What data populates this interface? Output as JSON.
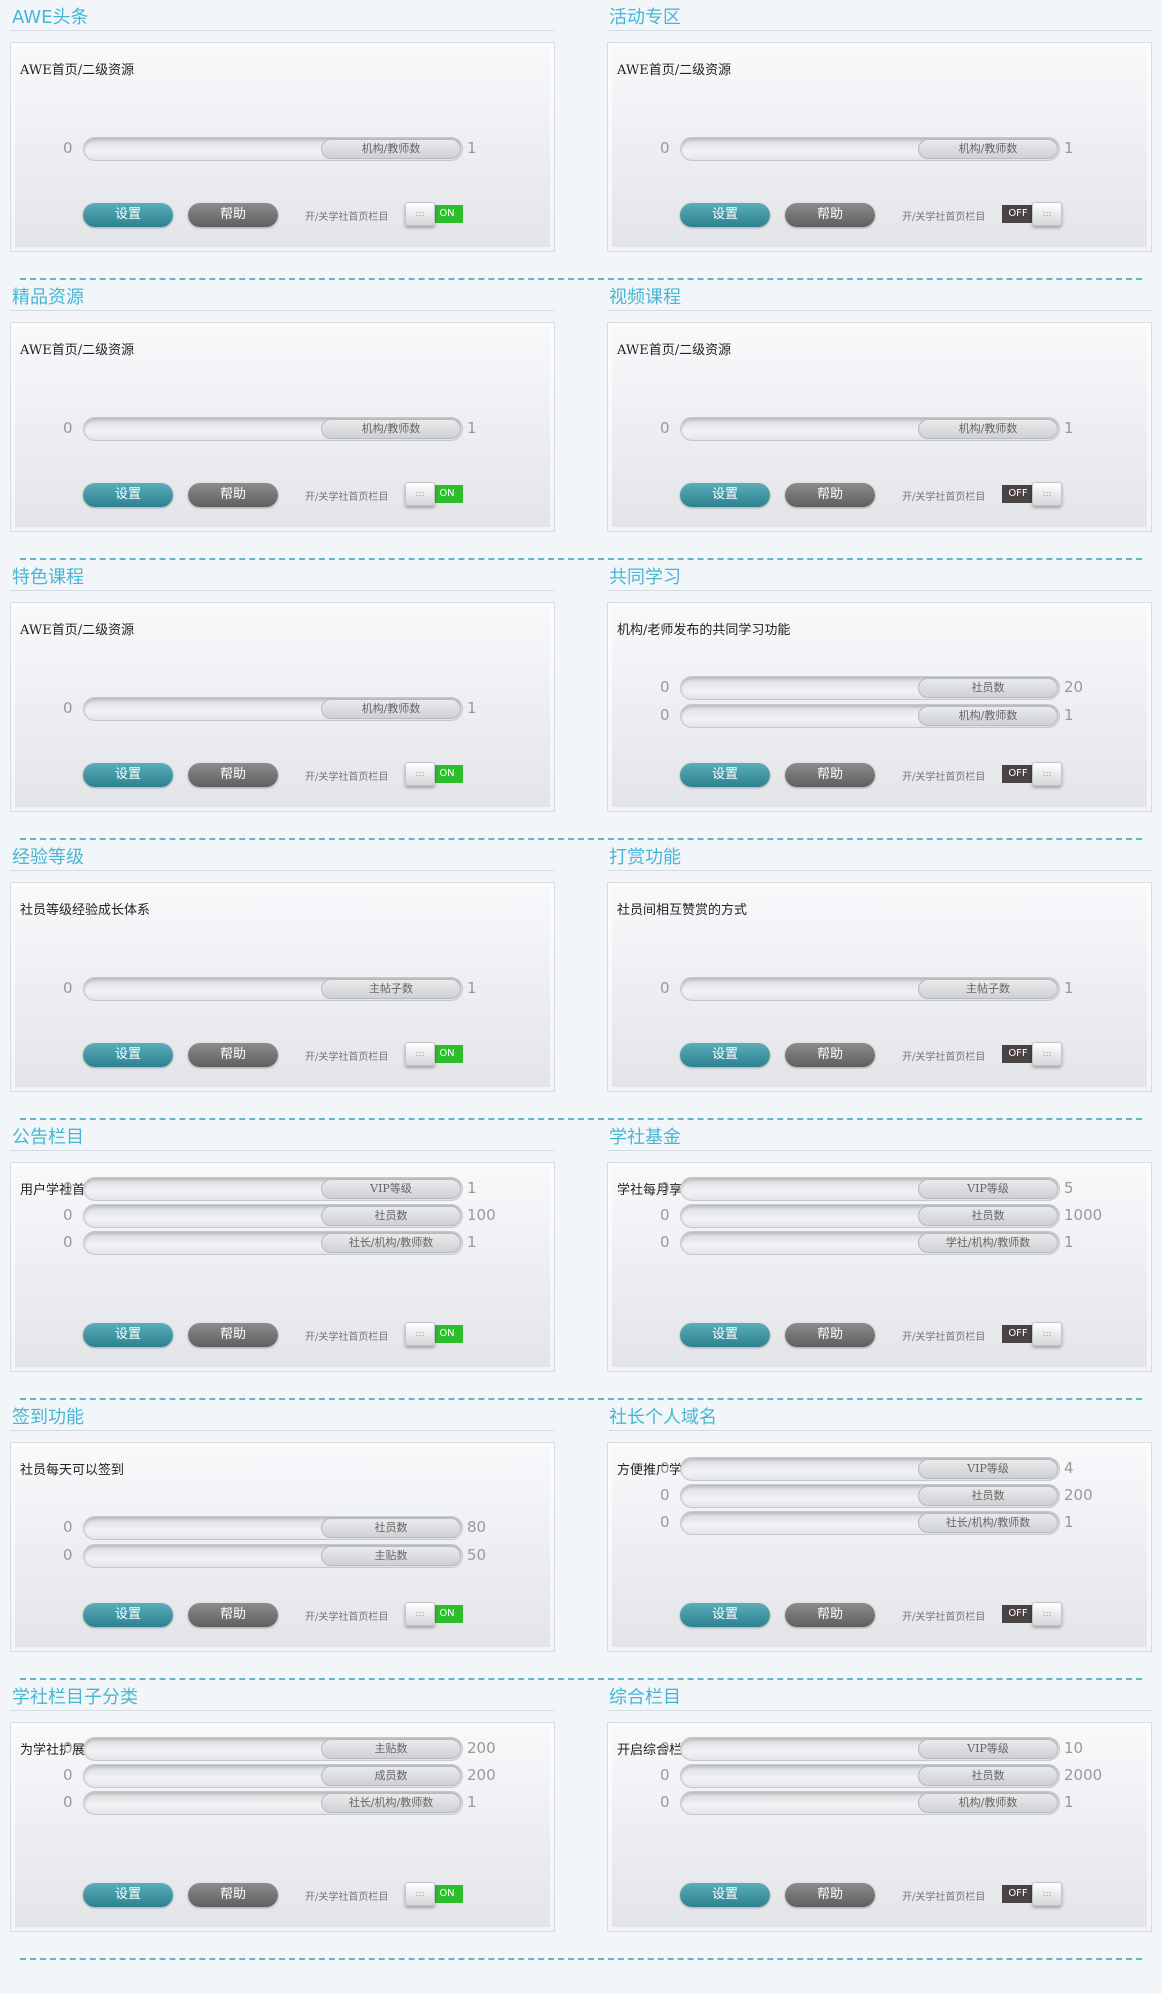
{
  "common": {
    "set_label": "设置",
    "help_label": "帮助",
    "toggle_label": "开/关学社首页栏目",
    "on_label": "ON",
    "off_label": "OFF",
    "min_value": "0",
    "knob_grip": ":::"
  },
  "colors": {
    "title": "#45b7d6",
    "set_button": "#3a909e",
    "help_button": "#737373",
    "toggle_on": "#2cbe2c",
    "toggle_off": "#4a4343",
    "divider": "#5fb8c6"
  },
  "sections": [
    {
      "title": "AWE头条",
      "desc": "AWE首页/二级资源",
      "enabled": true,
      "sliders": [
        {
          "label": "机构/教师数",
          "max": "1"
        }
      ]
    },
    {
      "title": "活动专区",
      "desc": "AWE首页/二级资源",
      "enabled": false,
      "sliders": [
        {
          "label": "机构/教师数",
          "max": "1"
        }
      ]
    },
    {
      "title": "精品资源",
      "desc": "AWE首页/二级资源",
      "enabled": true,
      "sliders": [
        {
          "label": "机构/教师数",
          "max": "1"
        }
      ]
    },
    {
      "title": "视频课程",
      "desc": "AWE首页/二级资源",
      "enabled": false,
      "sliders": [
        {
          "label": "机构/教师数",
          "max": "1"
        }
      ]
    },
    {
      "title": "特色课程",
      "desc": "AWE首页/二级资源",
      "enabled": true,
      "sliders": [
        {
          "label": "机构/教师数",
          "max": "1"
        }
      ]
    },
    {
      "title": "共同学习",
      "desc": "机构/老师发布的共同学习功能",
      "enabled": false,
      "sliders": [
        {
          "label": "社员数",
          "max": "20"
        },
        {
          "label": "机构/教师数",
          "max": "1"
        }
      ]
    },
    {
      "title": "经验等级",
      "desc": "社员等级经验成长体系",
      "enabled": true,
      "sliders": [
        {
          "label": "主帖子数",
          "max": "1"
        }
      ]
    },
    {
      "title": "打赏功能",
      "desc": "社员间相互赞赏的方式",
      "enabled": false,
      "sliders": [
        {
          "label": "主帖子数",
          "max": "1"
        }
      ]
    },
    {
      "title": "公告栏目",
      "desc": "用户学社首页的公告栏",
      "enabled": true,
      "sliders": [
        {
          "label": "VIP等级",
          "max": "1"
        },
        {
          "label": "社员数",
          "max": "100"
        },
        {
          "label": "社长/机构/教师数",
          "max": "1"
        }
      ]
    },
    {
      "title": "学社基金",
      "desc": "学社每月享受的抚恤金",
      "enabled": false,
      "sliders": [
        {
          "label": "VIP等级",
          "max": "5"
        },
        {
          "label": "社员数",
          "max": "1000"
        },
        {
          "label": "学社/机构/教师数",
          "max": "1"
        }
      ]
    },
    {
      "title": "签到功能",
      "desc": "社员每天可以签到",
      "enabled": true,
      "sliders": [
        {
          "label": "社员数",
          "max": "80"
        },
        {
          "label": "主贴数",
          "max": "50"
        }
      ]
    },
    {
      "title": "社长个人域名",
      "desc": "方便推广学社首页",
      "enabled": false,
      "sliders": [
        {
          "label": "VIP等级",
          "max": "4"
        },
        {
          "label": "社员数",
          "max": "200"
        },
        {
          "label": "社长/机构/教师数",
          "max": "1"
        }
      ]
    },
    {
      "title": "学社栏目子分类",
      "desc": "为学社扩展栏目的子分类",
      "enabled": true,
      "sliders": [
        {
          "label": "主贴数",
          "max": "200"
        },
        {
          "label": "成员数",
          "max": "200"
        },
        {
          "label": "社长/机构/教师数",
          "max": "1"
        }
      ]
    },
    {
      "title": "综合栏目",
      "desc": "开启综合栏目，有数据汇总，聊天系统，社员扩容等其它高级功能",
      "enabled": false,
      "sliders": [
        {
          "label": "VIP等级",
          "max": "10"
        },
        {
          "label": "社员数",
          "max": "2000"
        },
        {
          "label": "机构/教师数",
          "max": "1"
        }
      ]
    }
  ]
}
